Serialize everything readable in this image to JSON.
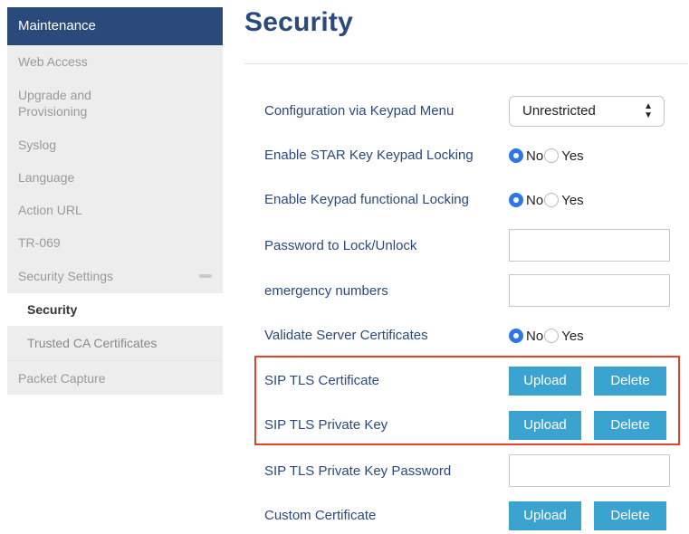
{
  "sidebar": {
    "header": "Maintenance",
    "items": [
      {
        "label": "Web Access"
      },
      {
        "label": "Upgrade and Provisioning"
      },
      {
        "label": "Syslog"
      },
      {
        "label": "Language"
      },
      {
        "label": "Action URL"
      },
      {
        "label": "TR-069"
      },
      {
        "label": "Security Settings"
      }
    ],
    "sub_items": [
      {
        "label": "Security"
      },
      {
        "label": "Trusted CA Certificates"
      }
    ],
    "bottom_item": {
      "label": "Packet Capture"
    }
  },
  "page": {
    "title": "Security"
  },
  "form": {
    "keypad_menu": {
      "label": "Configuration via Keypad Menu",
      "value": "Unrestricted"
    },
    "star_key_locking": {
      "label": "Enable STAR Key Keypad Locking",
      "option_no": "No",
      "option_yes": "Yes",
      "selected": "No"
    },
    "functional_locking": {
      "label": "Enable Keypad functional Locking",
      "option_no": "No",
      "option_yes": "Yes",
      "selected": "No"
    },
    "password_lock": {
      "label": "Password to Lock/Unlock",
      "value": ""
    },
    "emergency_numbers": {
      "label": "emergency numbers",
      "value": ""
    },
    "validate_server_certs": {
      "label": "Validate Server Certificates",
      "option_no": "No",
      "option_yes": "Yes",
      "selected": "No"
    },
    "sip_tls_certificate": {
      "label": "SIP TLS Certificate",
      "upload": "Upload",
      "delete": "Delete"
    },
    "sip_tls_private_key": {
      "label": "SIP TLS Private Key",
      "upload": "Upload",
      "delete": "Delete"
    },
    "sip_tls_key_password": {
      "label": "SIP TLS Private Key Password",
      "value": ""
    },
    "custom_certificate": {
      "label": "Custom Certificate",
      "upload": "Upload",
      "delete": "Delete"
    }
  },
  "colors": {
    "brand": "#2a4a7c",
    "button": "#3ba3cf",
    "radio_selected": "#2b78e4",
    "highlight": "#e5432c",
    "sidebar_bg": "#ededed"
  }
}
